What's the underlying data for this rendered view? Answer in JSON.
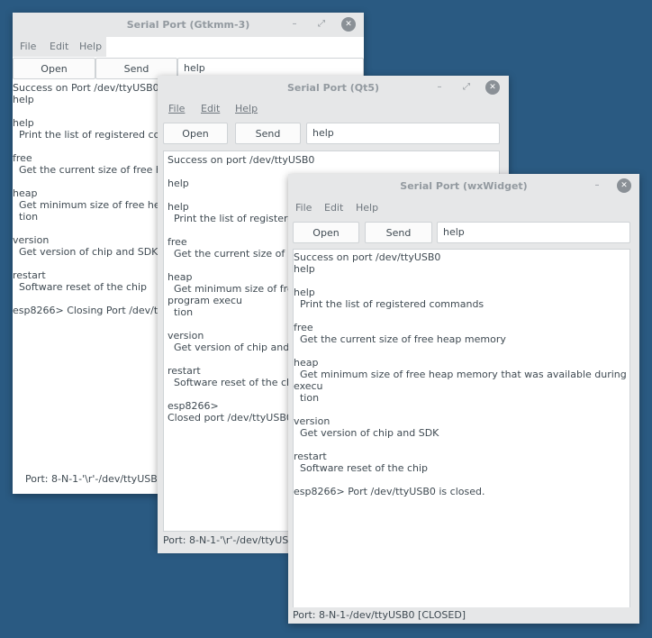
{
  "gtk": {
    "title": "Serial Port (Gtkmm-3)",
    "menu": [
      "File",
      "Edit",
      "Help"
    ],
    "open_label": "Open",
    "send_label": "Send",
    "input_value": "help",
    "output": [
      "Success on Port /dev/ttyUSB0",
      "help",
      "",
      "help",
      "  Print the list of registered commands",
      "",
      "free",
      "  Get the current size of free heap memory",
      "",
      "heap",
      "  Get minimum size of free heap memory",
      "  tion",
      "",
      "version",
      "  Get version of chip and SDK",
      "",
      "restart",
      "  Software reset of the chip",
      "",
      "esp8266> Closing Port /dev/ttyUSB0"
    ],
    "status": "Port: 8-N-1-'\\r'-/dev/ttyUSB0 [CLOSED]"
  },
  "qt": {
    "title": "Serial Port (Qt5)",
    "menu": [
      "File",
      "Edit",
      "Help"
    ],
    "open_label": "Open",
    "send_label": "Send",
    "input_value": "help",
    "output": [
      "Success on port /dev/ttyUSB0",
      "",
      "help",
      "",
      "help",
      "  Print the list of registered commands",
      "",
      "free",
      "  Get the current size of free heap memory",
      "",
      "heap",
      "  Get minimum size of free heap memory that was available during",
      "program execu",
      "  tion",
      "",
      "version",
      "  Get version of chip and SDK",
      "",
      "restart",
      "  Software reset of the chip",
      "",
      "esp8266>",
      "Closed port /dev/ttyUSB0"
    ],
    "status": "Port: 8-N-1-'\\r'-/dev/ttyUSB0"
  },
  "wx": {
    "title": "Serial Port (wxWidget)",
    "menu": [
      "File",
      "Edit",
      "Help"
    ],
    "open_label": "Open",
    "send_label": "Send",
    "input_value": "help",
    "output": [
      "Success on port /dev/ttyUSB0",
      "help",
      "",
      "help",
      "  Print the list of registered commands",
      "",
      "free",
      "  Get the current size of free heap memory",
      "",
      "heap",
      "  Get minimum size of free heap memory that was available during program",
      "execu",
      "  tion",
      "",
      "version",
      "  Get version of chip and SDK",
      "",
      "restart",
      "  Software reset of the chip",
      "",
      "esp8266> Port /dev/ttyUSB0 is closed."
    ],
    "status": "Port: 8-N-1-/dev/ttyUSB0 [CLOSED]"
  },
  "icons": {
    "minimize": "–",
    "maximize": "⤢",
    "close": "✕"
  },
  "colors": {
    "desktop": "#2a5a82",
    "titlebar": "#e6e7e8",
    "close_button": "#8a9096"
  }
}
